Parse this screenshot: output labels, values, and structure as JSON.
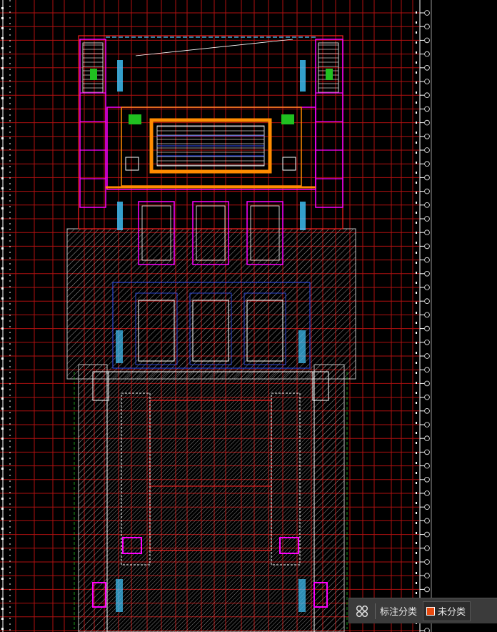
{
  "canvas": {
    "background": "#000000"
  },
  "colors": {
    "grid": "#b01010",
    "axis": "#ffffff",
    "wall": "#ff2020",
    "magenta": "#ff00ff",
    "orange": "#ff8c00",
    "cyan": "#40c8ff",
    "hatch": "#c0c0c0",
    "green": "#20c020",
    "blue": "#3050ff",
    "swatch": "#e84a10"
  },
  "annotation_bar": {
    "icon": "grid-four-icon",
    "label": "标注分类",
    "category": "未分类"
  }
}
